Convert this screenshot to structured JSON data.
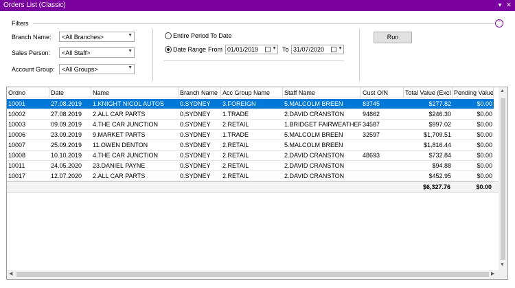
{
  "window": {
    "title": "Orders List (Classic)",
    "menu_glyph": "▾",
    "close_glyph": "✕"
  },
  "filters": {
    "legend": "Filters",
    "collapse_glyph": "⌃",
    "branch": {
      "label": "Branch Name:",
      "value": "<All Branches>"
    },
    "sales_person": {
      "label": "Sales Person:",
      "value": "<All Staff>"
    },
    "account_group": {
      "label": "Account Group:",
      "value": "<All Groups>"
    },
    "period": {
      "entire_label": "Entire Period To Date",
      "range_label": "Date Range",
      "selected": "range",
      "from_label": "From",
      "from_value": "01/01/2019",
      "to_label": "To",
      "to_value": "31/07/2020"
    },
    "run_label": "Run"
  },
  "grid": {
    "columns": [
      "Ordno",
      "Date",
      "Name",
      "Branch Name",
      "Acc Group Name",
      "Staff Name",
      "Cust O/N",
      "Total Value (Excl",
      "Pending Value"
    ],
    "rows": [
      [
        "10001",
        "27.08.2019",
        "1.KNIGHT NICOL AUTOS",
        "0.SYDNEY",
        "3.FOREIGN",
        "5.MALCOLM BREEN",
        "83745",
        "$277.82",
        "$0.00"
      ],
      [
        "10002",
        "27.08.2019",
        "2.ALL CAR PARTS",
        "0.SYDNEY",
        "1.TRADE",
        "2.DAVID CRANSTON",
        "94862",
        "$246.30",
        "$0.00"
      ],
      [
        "10003",
        "09.09.2019",
        "4.THE CAR JUNCTION",
        "0.SYDNEY",
        "2.RETAIL",
        "1.BRIDGET FAIRWEATHER",
        "34587",
        "$997.02",
        "$0.00"
      ],
      [
        "10006",
        "23.09.2019",
        "9.MARKET PARTS",
        "0.SYDNEY",
        "1.TRADE",
        "5.MALCOLM BREEN",
        "32597",
        "$1,709.51",
        "$0.00"
      ],
      [
        "10007",
        "25.09.2019",
        "11.OWEN DENTON",
        "0.SYDNEY",
        "2.RETAIL",
        "5.MALCOLM BREEN",
        "",
        "$1,816.44",
        "$0.00"
      ],
      [
        "10008",
        "10.10.2019",
        "4.THE CAR JUNCTION",
        "0.SYDNEY",
        "2.RETAIL",
        "2.DAVID CRANSTON",
        "48693",
        "$732.84",
        "$0.00"
      ],
      [
        "10011",
        "24.05.2020",
        "23.DANIEL PAYNE",
        "0.SYDNEY",
        "2.RETAIL",
        "2.DAVID CRANSTON",
        "",
        "$94.88",
        "$0.00"
      ],
      [
        "10017",
        "12.07.2020",
        "2.ALL CAR PARTS",
        "0.SYDNEY",
        "2.RETAIL",
        "2.DAVID CRANSTON",
        "",
        "$452.95",
        "$0.00"
      ]
    ],
    "selected_row": 0,
    "totals": {
      "total_value": "$6,327.76",
      "pending_value": "$0.00"
    }
  },
  "colors": {
    "titlebar": "#7a00a0",
    "selection": "#0078d7"
  }
}
